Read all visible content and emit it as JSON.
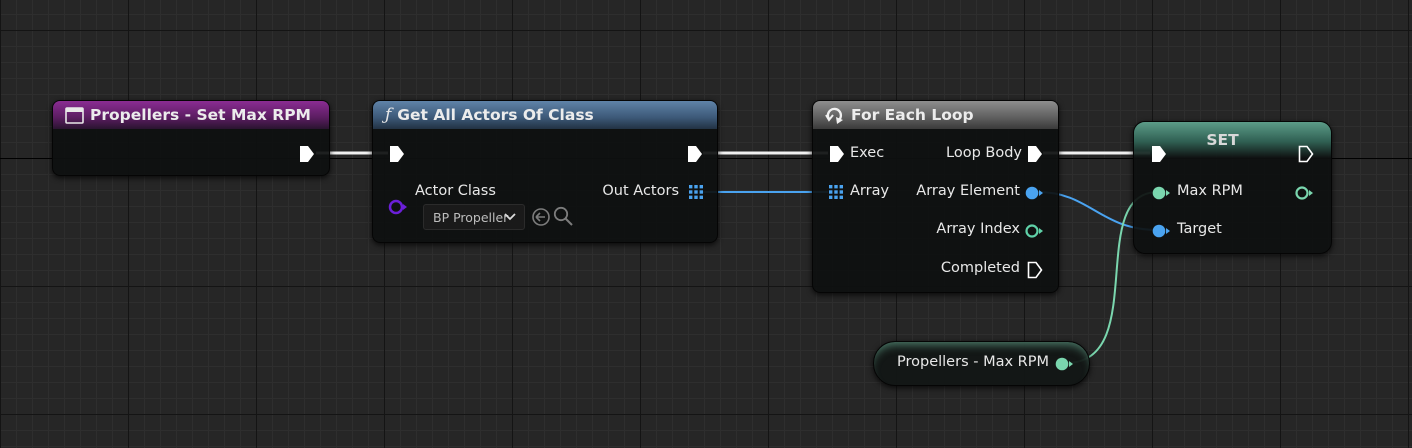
{
  "colors": {
    "event_header": "#8a2c92",
    "function_header": "#5f83a8",
    "macro_header": "#8e8e8e",
    "set_header": "#5c9c88",
    "object_pin": "#4aa3f0",
    "class_pin": "#6b1fd8",
    "float_pin": "#7ad6ae",
    "int_pin": "#5fd1a8",
    "exec_pin": "#ffffff"
  },
  "nodes": {
    "event": {
      "title": "Propellers - Set Max RPM",
      "icon": "event-icon"
    },
    "get_all_actors": {
      "title": "Get All Actors Of Class",
      "icon": "function-icon",
      "actor_class_label": "Actor Class",
      "actor_class_value": "BP Propeller",
      "out_actors_label": "Out Actors"
    },
    "for_each": {
      "title": "For Each Loop",
      "icon": "loop-macro-icon",
      "exec_label": "Exec",
      "array_label": "Array",
      "loop_body_label": "Loop Body",
      "array_element_label": "Array Element",
      "array_index_label": "Array Index",
      "completed_label": "Completed"
    },
    "set": {
      "title": "SET",
      "max_rpm_label": "Max RPM",
      "target_label": "Target"
    },
    "variable": {
      "label": "Propellers - Max RPM"
    }
  }
}
